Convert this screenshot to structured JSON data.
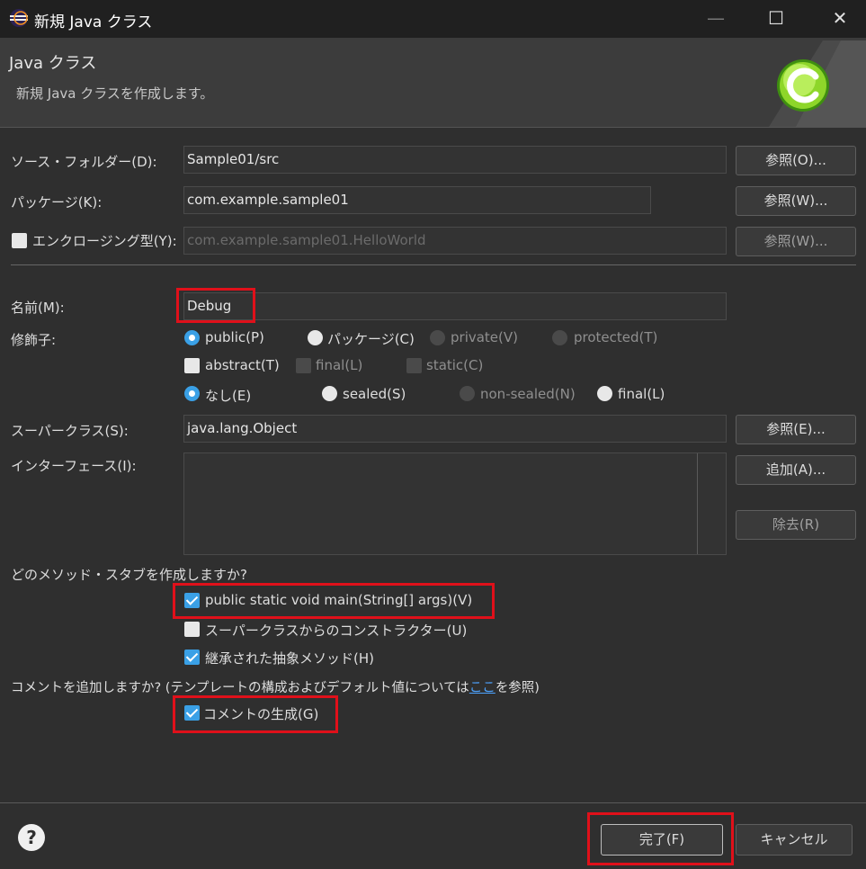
{
  "window": {
    "title": "新規 Java クラス",
    "minimize": "—",
    "maximize": "☐",
    "close": "✕"
  },
  "header": {
    "title": "Java クラス",
    "description": "新規 Java クラスを作成します。"
  },
  "form": {
    "source_folder": {
      "label": "ソース・フォルダー(D):",
      "value": "Sample01/src",
      "button": "参照(O)..."
    },
    "package": {
      "label": "パッケージ(K):",
      "value": "com.example.sample01",
      "button": "参照(W)..."
    },
    "enclosing": {
      "label": "エンクロージング型(Y):",
      "checked": false,
      "value": "com.example.sample01.HelloWorld",
      "button": "参照(W)..."
    },
    "name": {
      "label": "名前(M):",
      "value": "Debug"
    },
    "modifiers": {
      "label": "修飾子:",
      "access": [
        {
          "label": "public(P)",
          "state": "selected"
        },
        {
          "label": "パッケージ(C)",
          "state": "normal"
        },
        {
          "label": "private(V)",
          "state": "disabled"
        },
        {
          "label": "protected(T)",
          "state": "disabled"
        }
      ],
      "flags": [
        {
          "label": "abstract(T)",
          "state": "normal"
        },
        {
          "label": "final(L)",
          "state": "disabled"
        },
        {
          "label": "static(C)",
          "state": "disabled"
        }
      ],
      "sealing": [
        {
          "label": "なし(E)",
          "state": "selected"
        },
        {
          "label": "sealed(S)",
          "state": "normal"
        },
        {
          "label": "non-sealed(N)",
          "state": "disabled"
        },
        {
          "label": "final(L)",
          "state": "normal"
        }
      ]
    },
    "superclass": {
      "label": "スーパークラス(S):",
      "value": "java.lang.Object",
      "button": "参照(E)..."
    },
    "interfaces": {
      "label": "インターフェース(I):",
      "add_button": "追加(A)...",
      "remove_button": "除去(R)"
    },
    "stubs": {
      "question": "どのメソッド・スタブを作成しますか?",
      "options": [
        {
          "label": "public static void main(String[] args)(V)",
          "checked": true
        },
        {
          "label": "スーパークラスからのコンストラクター(U)",
          "checked": false
        },
        {
          "label": "継承された抽象メソッド(H)",
          "checked": true
        }
      ]
    },
    "comments": {
      "question_before": "コメントを追加しますか? (テンプレートの構成およびデフォルト値については",
      "question_link": "ここ",
      "question_after": "を参照)",
      "generate": {
        "label": "コメントの生成(G)",
        "checked": true
      }
    }
  },
  "footer": {
    "help": "?",
    "finish": "完了(F)",
    "cancel": "キャンセル"
  },
  "colors": {
    "accent": "#3aa0e6",
    "highlight_box": "#e0101a",
    "background": "#2f2f2f"
  }
}
